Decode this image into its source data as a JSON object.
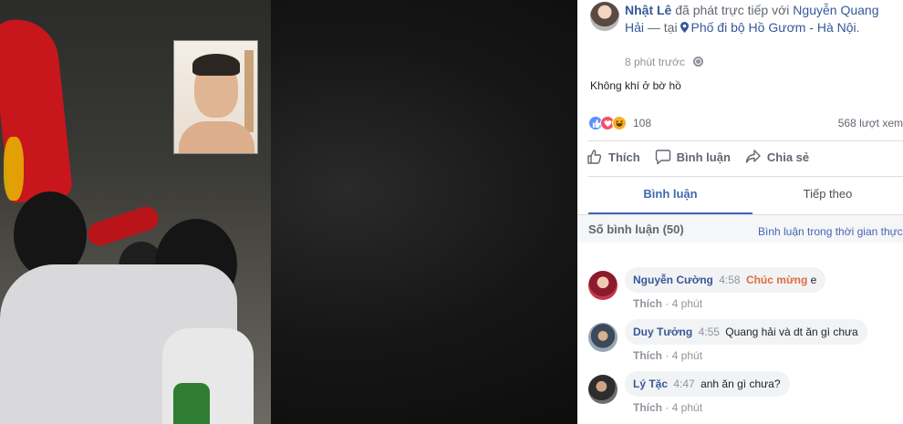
{
  "post": {
    "author": "Nhật Lê",
    "action_text": " đã phát trực tiếp với ",
    "tagged": "Nguyễn Quang Hải",
    "at_text": " — tại ",
    "location": "Phố đi bộ Hồ Gươm - Hà Nội",
    "location_end": ".",
    "time": "8 phút trước",
    "text": "Không khí ở bờ hồ",
    "reaction_count": "108",
    "views": "568 lượt xem"
  },
  "actions": {
    "like": "Thích",
    "comment": "Bình luận",
    "share": "Chia sẻ"
  },
  "tabs": {
    "comments": "Bình luận",
    "follow": "Tiếp theo"
  },
  "comments_header": {
    "count": "Số bình luận (50)",
    "order": "Bình luận trong thời gian thực"
  },
  "comments": [
    {
      "name": "Nguyễn Cường",
      "time": "4:58",
      "highlight": "Chúc mừng",
      "text": " e",
      "like": "Thích",
      "age": "4 phút"
    },
    {
      "name": "Duy Tưởng",
      "time": "4:55",
      "highlight": "",
      "text": "Quang hải và dt ăn gì chưa",
      "like": "Thích",
      "age": "4 phút"
    },
    {
      "name": "Lý Tặc",
      "time": "4:47",
      "highlight": "",
      "text": "anh ăn gì chưa?",
      "like": "Thích",
      "age": "4 phút"
    }
  ],
  "colors": {
    "link": "#365899",
    "accent": "#4267b2",
    "highlight": "#e06c3c",
    "flag_red": "#c8161d"
  }
}
